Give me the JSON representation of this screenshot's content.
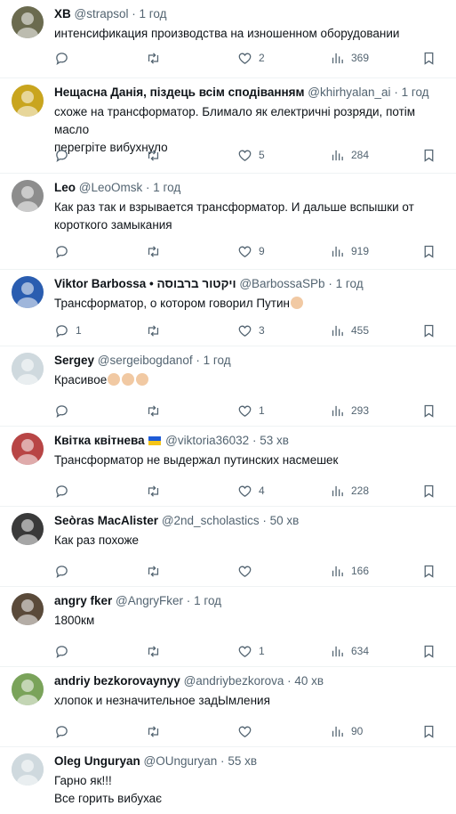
{
  "tweets": [
    {
      "name": "ХВ",
      "handle": "@strapsol",
      "dot": "·",
      "time": "1 год",
      "text": "интенсификация производства на изношенном оборудовании",
      "replies": "",
      "retweets": "",
      "likes": "2",
      "views": "369",
      "avatar": "#6b6b4f"
    },
    {
      "name": "Нещасна Данія, піздець всім сподіванням",
      "handle": "@khirhyalan_ai",
      "dot": "·",
      "time": "1 год",
      "text": "схоже на трансформатор. Блимало як електричні розряди, потім масло\nперегріте вибухнуло",
      "replies": "",
      "retweets": "",
      "likes": "5",
      "views": "284",
      "avatar": "#c9a51e"
    },
    {
      "name": "Leo",
      "handle": "@LeoOmsk",
      "dot": "·",
      "time": "1 год",
      "text": "Как раз так и взрывается трансформатор. И дальше вспышки от\nкороткого замыкания",
      "replies": "",
      "retweets": "",
      "likes": "9",
      "views": "919",
      "avatar": "#8d8d8d"
    },
    {
      "name": "Viktor Barbossa • ויקטור ברבוסה",
      "handle": "@BarbossaSPb",
      "dot": "·",
      "time": "1 год",
      "text": "Трансформатор, о котором говорил Путин",
      "emoji_count": 1,
      "replies": "1",
      "retweets": "",
      "likes": "3",
      "views": "455",
      "avatar": "#2a5db0"
    },
    {
      "name": "Sergey",
      "handle": "@sergeibogdanof",
      "dot": "·",
      "time": "1 год",
      "text": "Красивое",
      "emoji_count": 3,
      "replies": "",
      "retweets": "",
      "likes": "1",
      "views": "293",
      "avatar": "#cfd9de"
    },
    {
      "name": "Квітка квітнева",
      "handle": "@viktoria36032",
      "dot": "·",
      "time": "53 хв",
      "text": "Трансформатор не выдержал путинских насмешек",
      "flag": true,
      "replies": "",
      "retweets": "",
      "likes": "4",
      "views": "228",
      "avatar": "#b84545"
    },
    {
      "name": "Seòras MacAlister",
      "handle": "@2nd_scholastics",
      "dot": "·",
      "time": "50 хв",
      "text": "Как раз похоже",
      "replies": "",
      "retweets": "",
      "likes": "",
      "views": "166",
      "avatar": "#3a3a3a"
    },
    {
      "name": "angry fker",
      "handle": "@AngryFker",
      "dot": "·",
      "time": "1 год",
      "text": "1800км",
      "replies": "",
      "retweets": "",
      "likes": "1",
      "views": "634",
      "avatar": "#5a4a3a"
    },
    {
      "name": "andriy bezkorovaynyy",
      "handle": "@andriybezkorova",
      "dot": "·",
      "time": "40 хв",
      "text": "хлопок и незначительное задЫмления",
      "replies": "",
      "retweets": "",
      "likes": "",
      "views": "90",
      "avatar": "#7aa35a"
    },
    {
      "name": "Oleg Unguryan",
      "handle": "@OUnguryan",
      "dot": "·",
      "time": "55 хв",
      "text": "Гарно як!!!\nВсе горить вибухає",
      "replies": "",
      "retweets": "",
      "likes": "",
      "views": "",
      "avatar": "#cfd9de"
    }
  ],
  "icons": {
    "reply": "reply-icon",
    "retweet": "retweet-icon",
    "like": "like-icon",
    "views": "views-icon",
    "bookmark": "bookmark-icon",
    "share": "share-icon"
  }
}
